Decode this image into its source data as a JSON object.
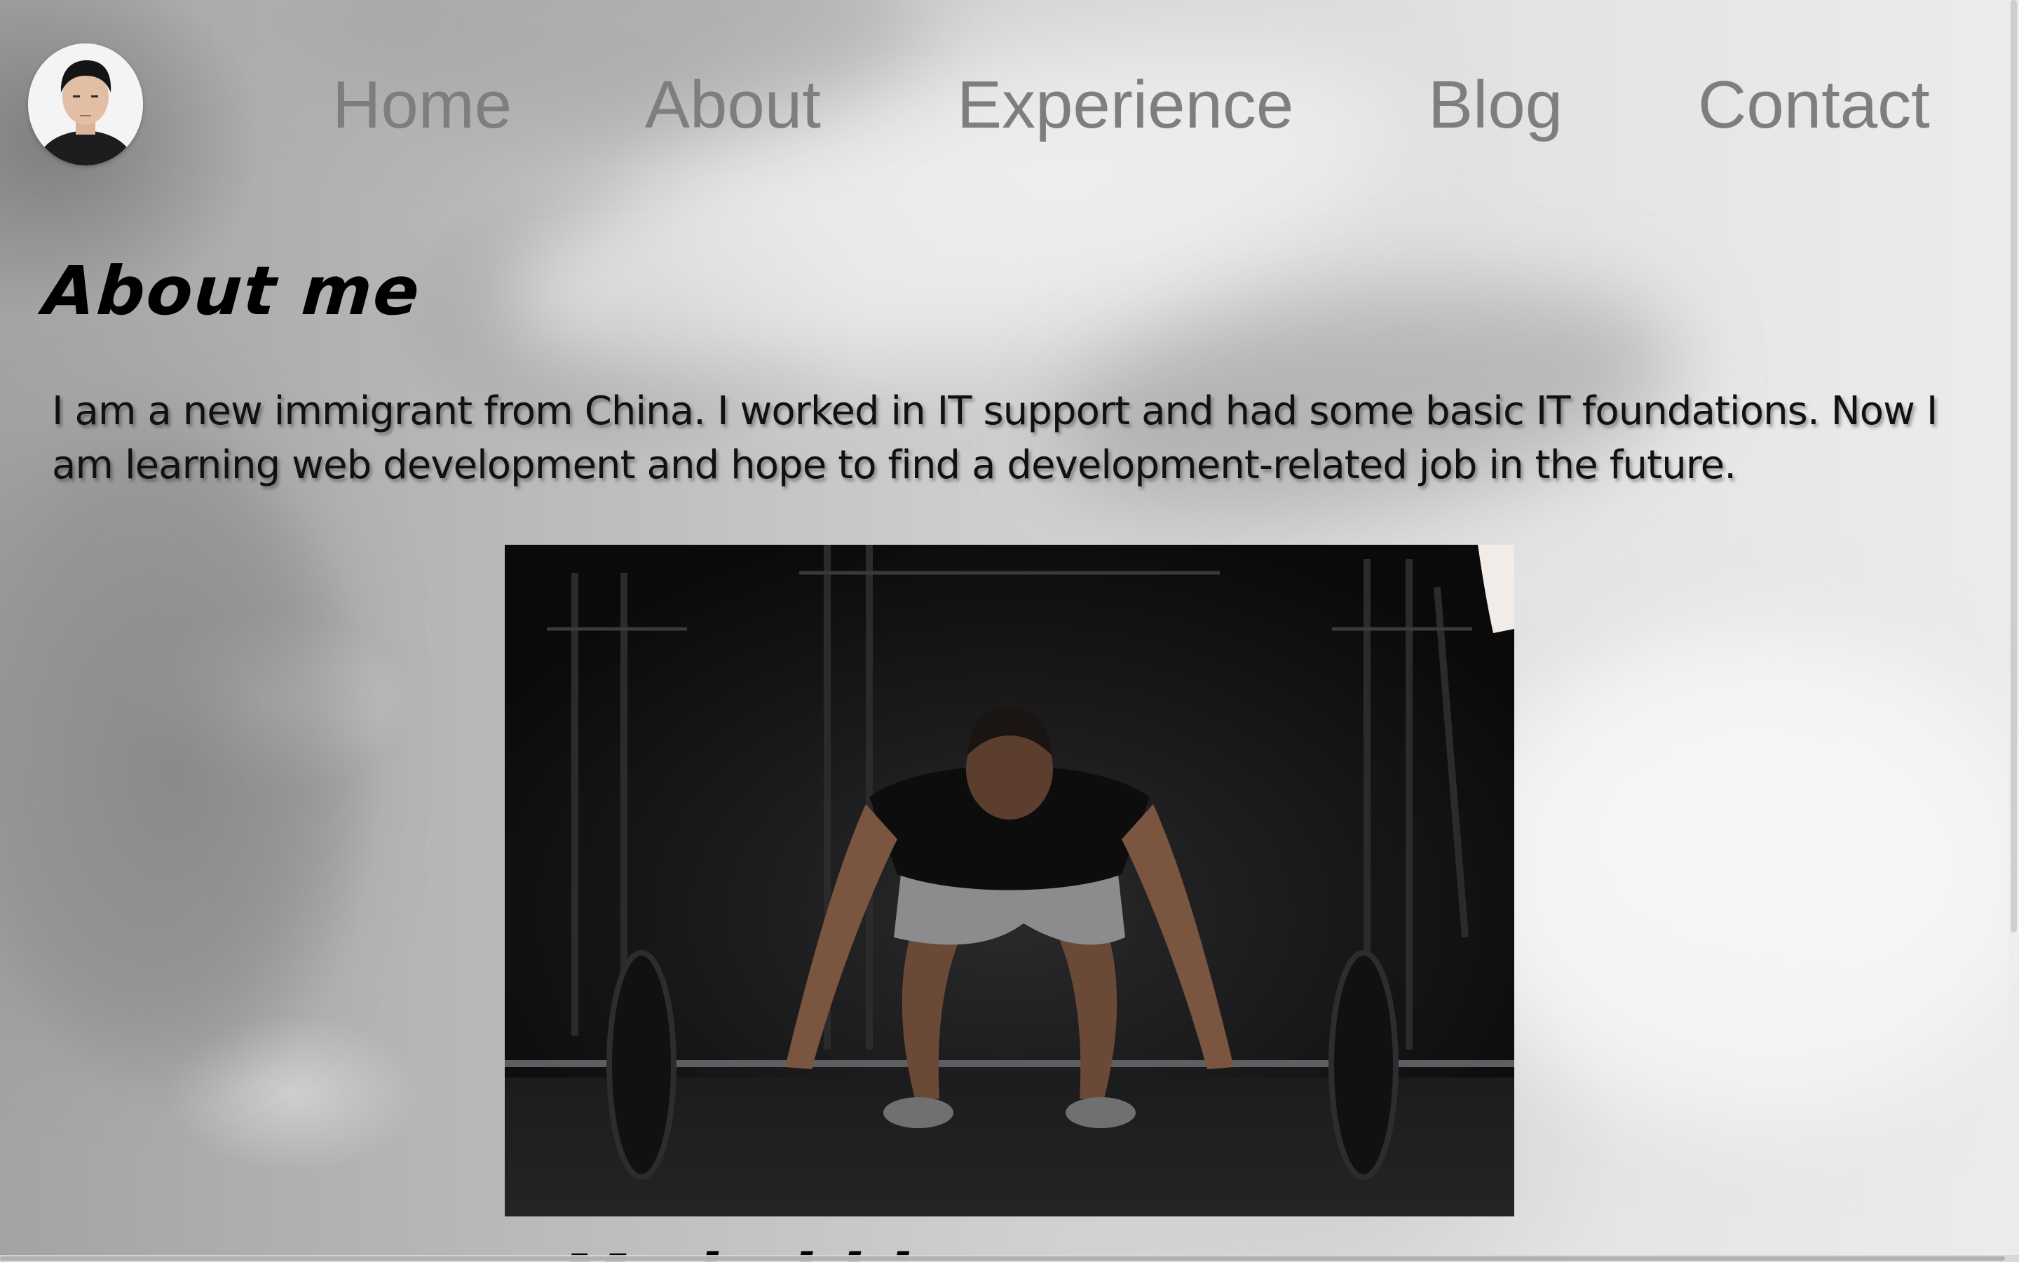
{
  "nav": {
    "items": [
      {
        "label": "Home"
      },
      {
        "label": "About"
      },
      {
        "label": "Experience"
      },
      {
        "label": "Blog"
      },
      {
        "label": "Contact"
      }
    ]
  },
  "about": {
    "title": "About me",
    "text": "I am a new immigrant from China. I worked in IT support and had some basic IT foundations. Now I am learning web development and hope to find a development-related job in the future."
  },
  "next_section": {
    "title": "My hobbies"
  },
  "colors": {
    "nav_text": "#7e7e80",
    "heading": "#000000",
    "body_text": "#111111"
  }
}
